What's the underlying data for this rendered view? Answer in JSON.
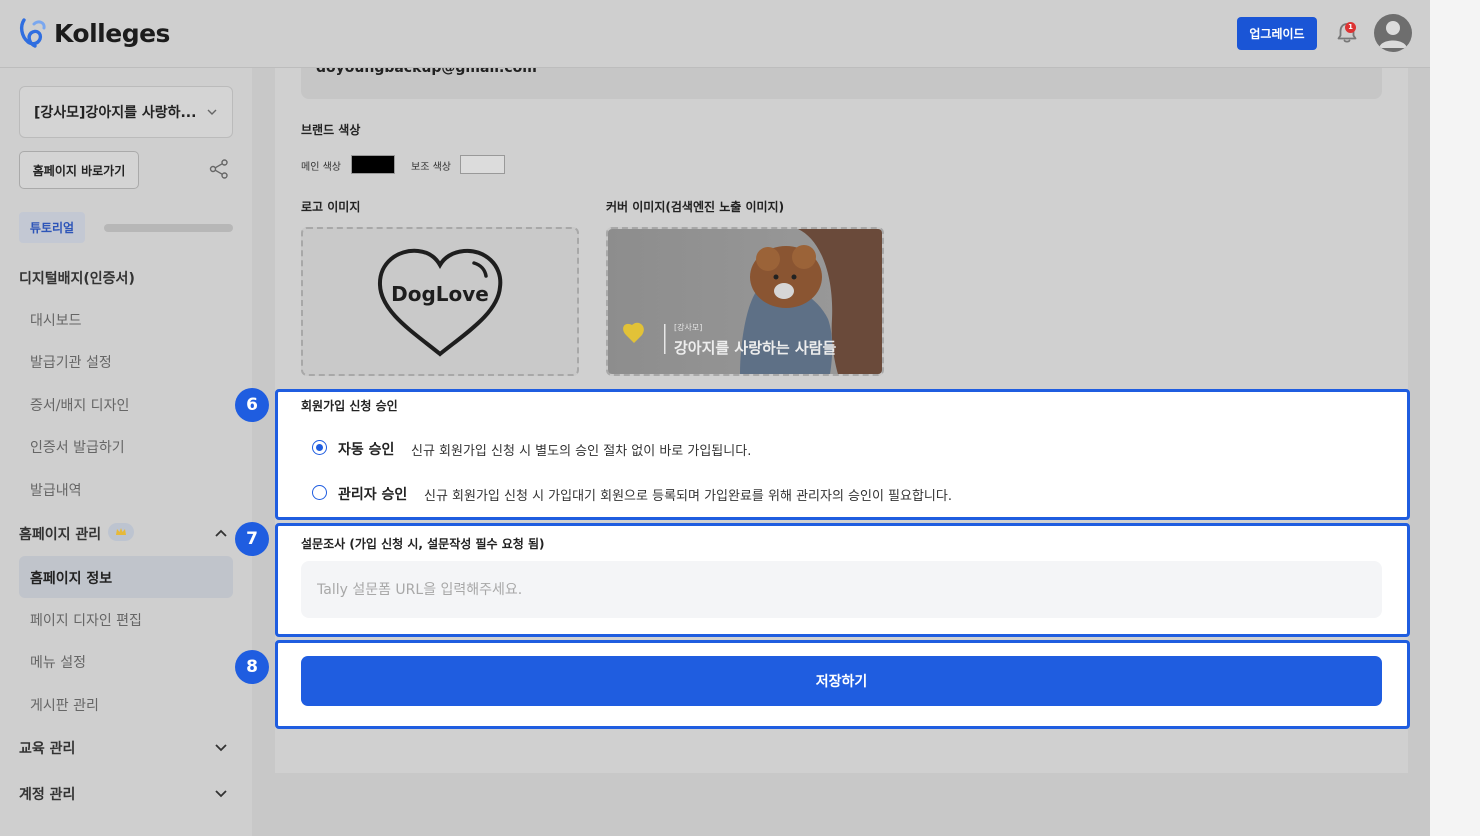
{
  "header": {
    "logo_text": "Kolleges",
    "upgrade_label": "업그레이드",
    "notification_count": "1"
  },
  "sidebar": {
    "site_name": "[강사모]강아지를 사랑하...",
    "homepage_button": "홈페이지 바로가기",
    "tutorial_label": "튜토리얼",
    "tutorial_progress": 0,
    "sections": [
      {
        "label": "디지털배지(인증서)",
        "items": [
          "대시보드",
          "발급기관 설정",
          "증서/배지 디자인",
          "인증서 발급하기",
          "발급내역"
        ]
      },
      {
        "label": "홈페이지 관리",
        "items": [
          "홈페이지 정보",
          "페이지 디자인 편집",
          "메뉴 설정",
          "게시판 관리"
        ]
      },
      {
        "label": "교육 관리"
      },
      {
        "label": "계정 관리"
      }
    ],
    "active_item": "홈페이지 정보"
  },
  "form": {
    "email_value": "doyoungbackup@gmail.com",
    "brand_color_label": "브랜드 색상",
    "main_color_label": "메인 색상",
    "main_color": "#000000",
    "sub_color_label": "보조 색상",
    "sub_color": "#dcdcdc",
    "logo_label": "로고 이미지",
    "logo_image_text": "DogLove",
    "cover_label": "커버 이미지(검색엔진 노출 이미지)",
    "cover_small_text": "[강사모]",
    "cover_title_text": "강아지를 사랑하는 사람들"
  },
  "approval": {
    "step": "6",
    "title": "회원가입 신청 승인",
    "options": [
      {
        "title": "자동 승인",
        "desc": "신규 회원가입 신청 시 별도의 승인 절차 없이 바로 가입됩니다.",
        "selected": true
      },
      {
        "title": "관리자 승인",
        "desc": "신규 회원가입 신청 시 가입대기 회원으로 등록되며 가입완료를 위해 관리자의 승인이 필요합니다.",
        "selected": false
      }
    ]
  },
  "survey": {
    "step": "7",
    "title": "설문조사 (가입 신청 시, 설문작성 필수 요청 됨)",
    "placeholder": "Tally 설문폼 URL을 입력해주세요.",
    "value": ""
  },
  "save": {
    "step": "8",
    "label": "저장하기"
  },
  "colors": {
    "accent": "#1f5de0",
    "upgrade": "#1a55d6"
  }
}
